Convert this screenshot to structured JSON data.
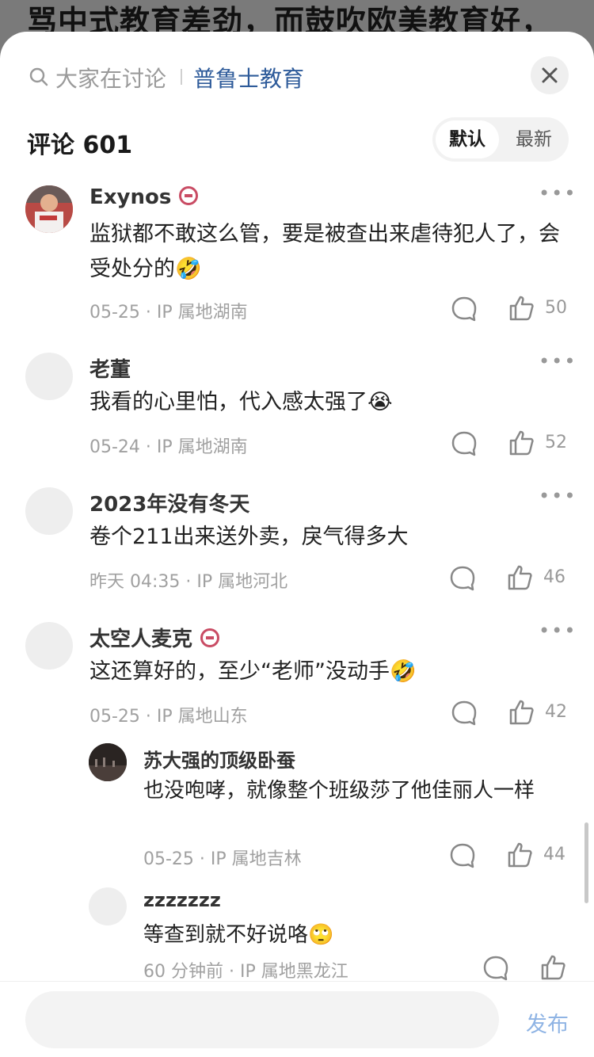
{
  "background_title": "骂中式教育差劲，而鼓吹欧美教育好，",
  "search": {
    "hint": "大家在讨论",
    "topic": "普鲁士教育"
  },
  "comments_header": {
    "title": "评论 601",
    "sort_default": "默认",
    "sort_latest": "最新"
  },
  "comments": [
    {
      "author": "Exynos",
      "text": "监狱都不敢这么管，要是被查出来虐待犯人了，会受处分的🤣",
      "meta": "05-25 · IP 属地湖南",
      "likes": "50"
    },
    {
      "author": "老董",
      "text": "我看的心里怕，代入感太强了😭",
      "meta": "05-24 · IP 属地湖南",
      "likes": "52"
    },
    {
      "author": "2023年没有冬天",
      "text": "卷个211出来送外卖，戾气得多大",
      "meta": "昨天 04:35 · IP 属地河北",
      "likes": "46"
    },
    {
      "author": "太空人麦克",
      "text": "这还算好的，至少“老师”没动手🤣",
      "meta": "05-25 · IP 属地山东",
      "likes": "42"
    }
  ],
  "replies": [
    {
      "author": "苏大强的顶级卧蚕",
      "text": "也没咆哮，就像整个班级莎了他佳丽人一样",
      "meta": "05-25 · IP 属地吉林",
      "likes": "44"
    },
    {
      "author": "zzzzzzz",
      "text": "等查到就不好说咯🙄",
      "meta": "60 分钟前 · IP 属地黑龙江",
      "likes": ""
    }
  ],
  "composer": {
    "placeholder": "",
    "publish_label": "发布"
  },
  "colors": {
    "topic_blue": "#2e5b9a",
    "publish_blue": "#8fb4e4",
    "meta_gray": "#a0a0a0",
    "badge_red": "#c94c64"
  },
  "icons": [
    "search-icon",
    "close-icon",
    "more-icon",
    "reply-icon",
    "like-icon"
  ]
}
